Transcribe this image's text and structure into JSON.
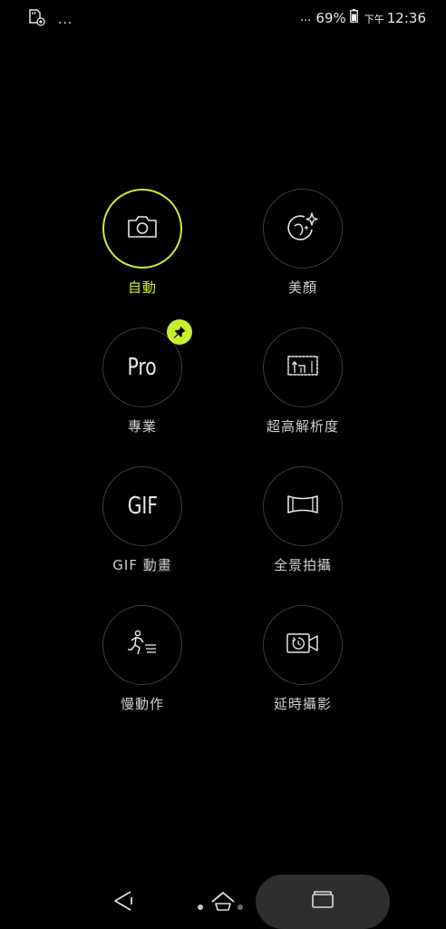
{
  "status_bar": {
    "left_dots": "...",
    "right_dots": "...",
    "battery_percent": "69%",
    "ampm": "下午",
    "time": "12:36"
  },
  "modes": [
    {
      "id": "auto",
      "label": "自動",
      "icon": "camera-icon",
      "active": true
    },
    {
      "id": "beauty",
      "label": "美顏",
      "icon": "beauty-face-icon",
      "active": false
    },
    {
      "id": "pro",
      "label": "專業",
      "icon_text": "Pro",
      "active": false,
      "pinned": true
    },
    {
      "id": "super-resolution",
      "label": "超高解析度",
      "icon": "super-resolution-icon",
      "active": false
    },
    {
      "id": "gif",
      "label": "GIF 動畫",
      "icon_text": "GIF",
      "active": false
    },
    {
      "id": "panorama",
      "label": "全景拍攝",
      "icon": "panorama-icon",
      "active": false
    },
    {
      "id": "slow-motion",
      "label": "慢動作",
      "icon": "slow-motion-runner-icon",
      "active": false
    },
    {
      "id": "time-lapse",
      "label": "延時攝影",
      "icon": "time-lapse-icon",
      "active": false
    }
  ],
  "colors": {
    "accent": "#c8ef2f",
    "background": "#000000",
    "ring": "#3c3c3c",
    "label": "#cfcfcf"
  },
  "nav_bar": {
    "icons": [
      "back-icon",
      "home-icon",
      "recents-icon"
    ]
  }
}
